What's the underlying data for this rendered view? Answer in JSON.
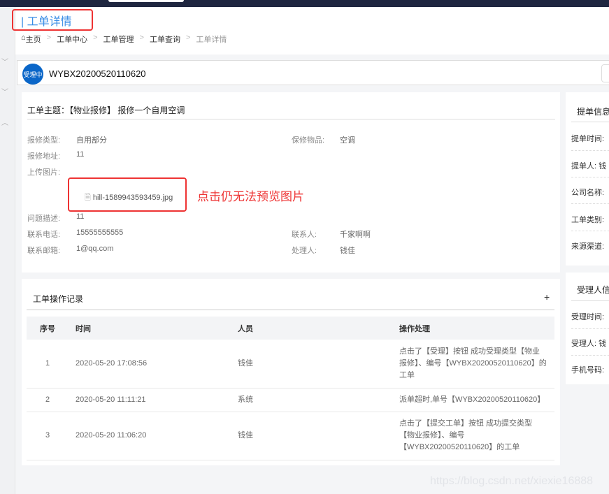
{
  "header": {
    "title": "| 工单详情",
    "breadcrumb": [
      "主页",
      "工单中心",
      "工单管理",
      "工单查询",
      "工单详情"
    ]
  },
  "order": {
    "status": "受理中",
    "number": "WYBX20200520110620",
    "status_color": "#0a66c8"
  },
  "detail": {
    "subject": "工单主题：【物业报修】 报修一个自用空调",
    "fields": [
      {
        "label": "报修类型:",
        "value": "自用部分"
      },
      {
        "label": "保修物品:",
        "value": "空调"
      },
      {
        "label": "报修地址:",
        "value": "11"
      },
      {
        "label": "上传图片:",
        "value": ""
      },
      {
        "label": "问题描述:",
        "value": "11"
      },
      {
        "label": "联系电话:",
        "value": "15555555555"
      },
      {
        "label": "联系人:",
        "value": "千家啊啊"
      },
      {
        "label": "联系邮箱:",
        "value": "1@qq.com"
      },
      {
        "label": "处理人:",
        "value": "钱佳"
      }
    ],
    "file": "hill-1589943593459.jpg",
    "annotation": "点击仍无法预览图片"
  },
  "records": {
    "title": "工单操作记录",
    "add": "+",
    "columns": [
      "序号",
      "时间",
      "人员",
      "操作处理"
    ],
    "rows": [
      [
        "1",
        "2020-05-20 17:08:56",
        "钱佳",
        "点击了【受理】按钮 成功受理类型【物业报修】、编号【WYBX20200520110620】的工单"
      ],
      [
        "2",
        "2020-05-20 11:11:21",
        "系统",
        "派单超时,单号【WYBX20200520110620】"
      ],
      [
        "3",
        "2020-05-20 11:06:20",
        "钱佳",
        "点击了【提交工单】按钮 成功提交类型【物业报修】、编号【WYBX20200520110620】的工单"
      ]
    ]
  },
  "side1": {
    "title": "提单信息",
    "items": [
      "提单时间:",
      "提单人: 钱",
      "公司名称:",
      "工单类别:",
      "来源渠道:"
    ]
  },
  "side2": {
    "title": "受理人信",
    "items": [
      "受理时间:",
      "受理人: 钱",
      "手机号码:"
    ]
  },
  "watermark": "https://blog.csdn.net/xiexie16888"
}
